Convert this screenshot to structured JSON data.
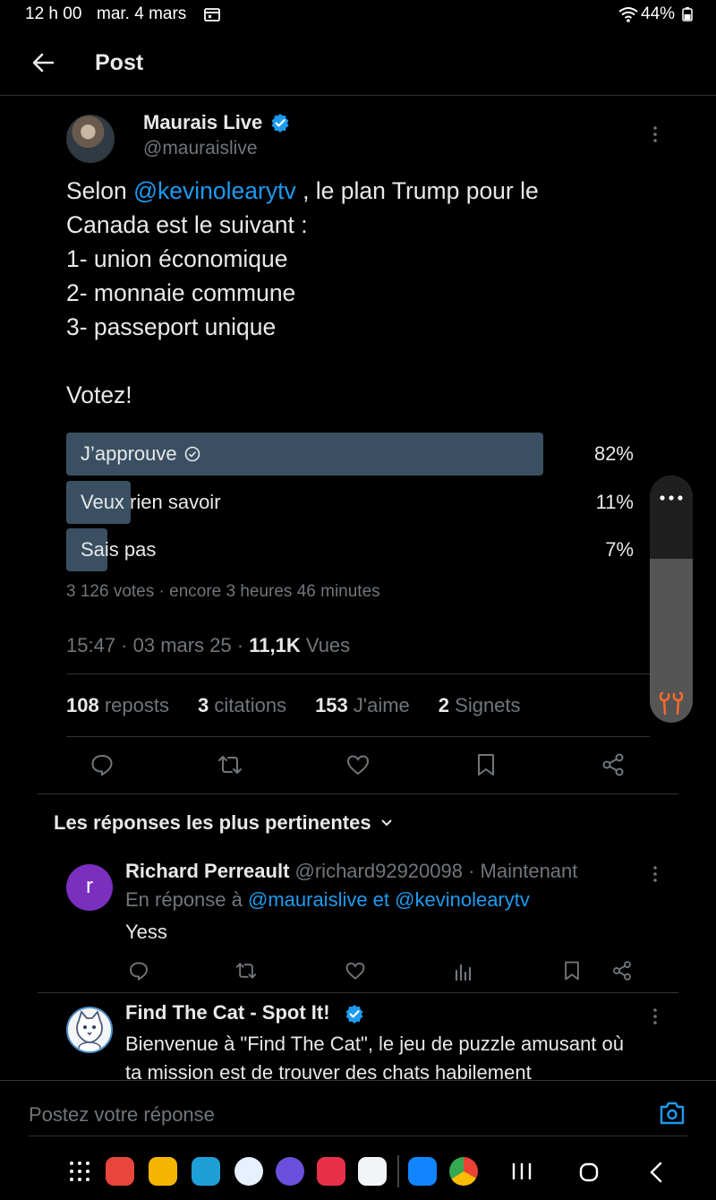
{
  "status": {
    "time": "12 h 00",
    "date": "mar. 4 mars",
    "battery": "44%"
  },
  "header": {
    "title": "Post"
  },
  "tweet": {
    "name": "Maurais Live",
    "handle": "@mauraislive",
    "text_pre": "Selon ",
    "mention": "@kevinolearytv",
    "text_post": " , le plan Trump pour le",
    "lines": [
      "Canada est le suivant :",
      "1- union économique",
      "2- monnaie commune",
      "3- passeport unique",
      "",
      "Votez!"
    ],
    "poll": {
      "options": [
        {
          "label": "J’approuve",
          "percent_text": "82%",
          "fraction": 0.82,
          "winner": true
        },
        {
          "label": "Veux rien savoir",
          "percent_text": "11%",
          "fraction": 0.11,
          "winner": false
        },
        {
          "label": "Sais pas",
          "percent_text": "7%",
          "fraction": 0.07,
          "winner": false
        }
      ],
      "meta": "3 126 votes · encore 3 heures 46 minutes"
    },
    "timestamp": "15:47 · 03 mars 25 · ",
    "views_count": "11,1K",
    "views_label": " Vues",
    "stats": [
      {
        "count": "108",
        "label": " reposts"
      },
      {
        "count": "3",
        "label": " citations"
      },
      {
        "count": "153",
        "label": " J'aime"
      },
      {
        "count": "2",
        "label": " Signets"
      }
    ]
  },
  "replies_header": "Les réponses les plus pertinentes",
  "replies": [
    {
      "avatar_letter": "r",
      "name": "Richard Perreault",
      "handle_time": " @richard92920098 · Maintenant",
      "reply_prefix": "En réponse à ",
      "reply_to": "@mauraislive et @kevinolearytv",
      "text": "Yess"
    },
    {
      "name": "Find The Cat - Spot It!",
      "text": "Bienvenue à \"Find The Cat\", le jeu de puzzle amusant où ta mission est de trouver des chats habilement"
    }
  ],
  "compose": {
    "placeholder": "Postez votre réponse"
  },
  "colors": {
    "accent": "#1d9bf0",
    "poll_bar": "#3a5062",
    "bg": "#000000"
  }
}
